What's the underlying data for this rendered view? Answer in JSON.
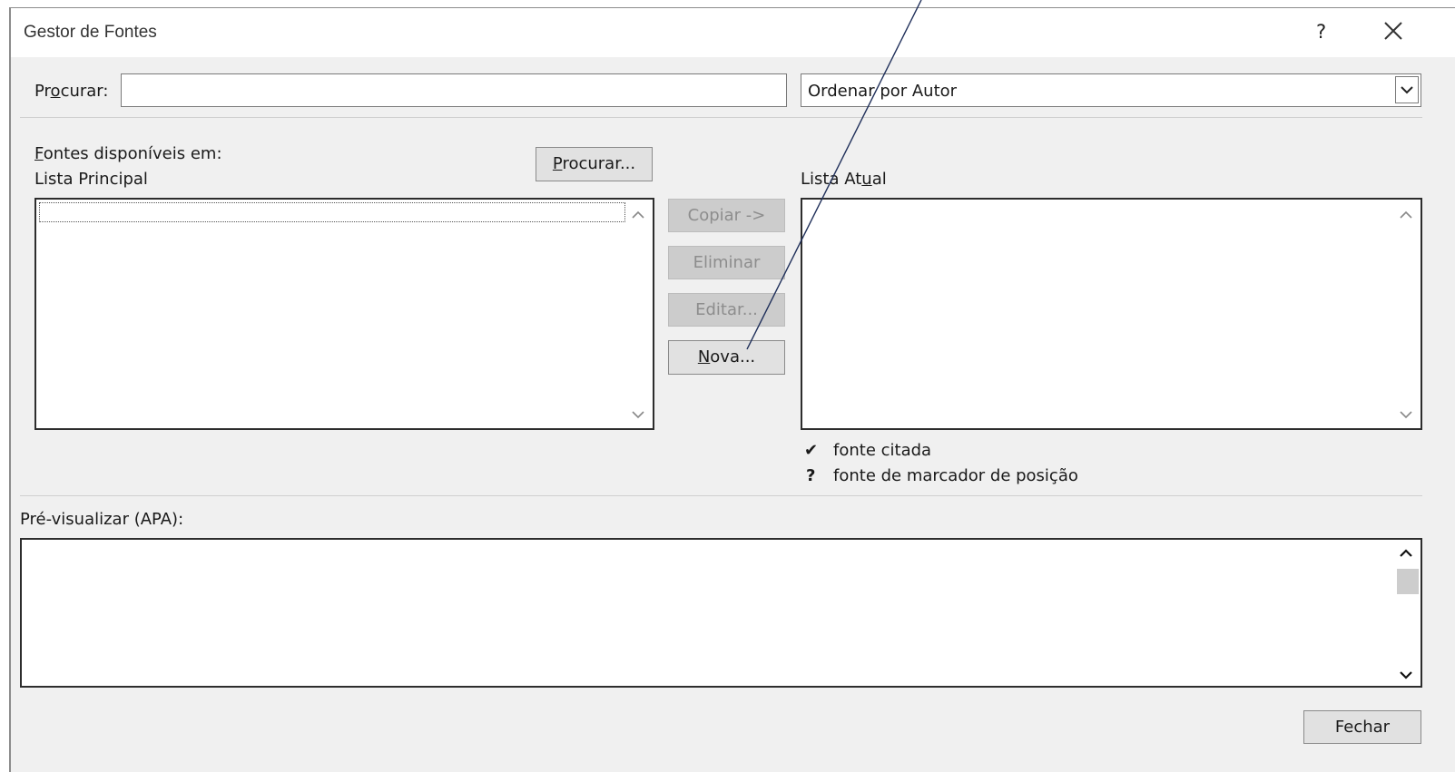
{
  "window": {
    "title": "Gestor de Fontes",
    "help_glyph": "?"
  },
  "search": {
    "label_pre": "Pr",
    "label_accel": "o",
    "label_post": "curar:",
    "value": "",
    "sort_selected": "Ordenar por Autor"
  },
  "available": {
    "label_accel": "F",
    "label_post": "ontes disponíveis em:",
    "list_name": "Lista Principal",
    "browse_accel": "P",
    "browse_post": "rocurar..."
  },
  "actions": {
    "copy_label": "Copiar ->",
    "delete_label": "Eliminar",
    "edit_label": "Editar...",
    "new_accel": "N",
    "new_post": "ova..."
  },
  "current": {
    "label_pre": "Lista At",
    "label_accel": "u",
    "label_post": "al"
  },
  "legend": {
    "cited_glyph": "✔",
    "cited_text": "fonte citada",
    "placeholder_glyph": "?",
    "placeholder_text": "fonte de marcador de posição"
  },
  "preview": {
    "label": "Pré-visualizar (APA):"
  },
  "footer": {
    "close_label": "Fechar"
  }
}
